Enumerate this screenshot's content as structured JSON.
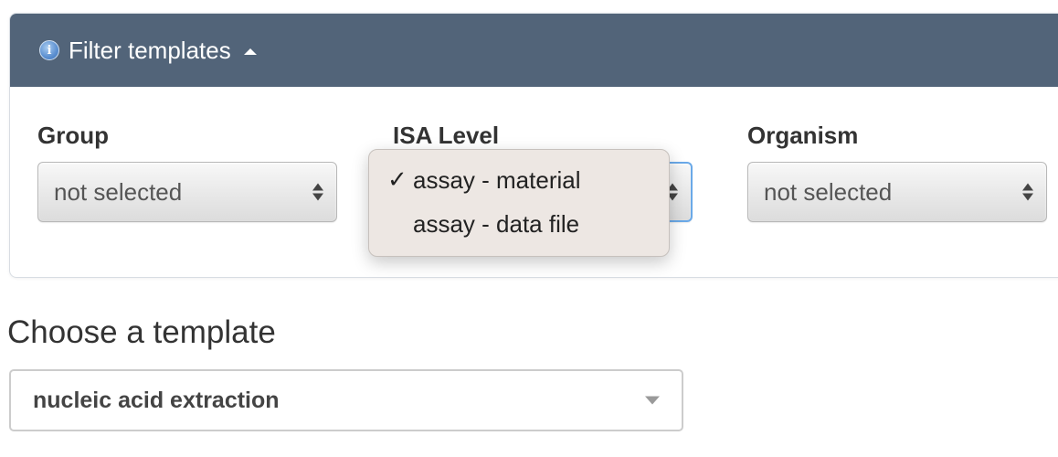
{
  "filter_panel": {
    "title": "Filter templates",
    "info_icon_glyph": "i",
    "fields": {
      "group": {
        "label": "Group",
        "value": "not selected"
      },
      "isa_level": {
        "label": "ISA Level",
        "dropdown_open": true,
        "options": [
          {
            "label": "assay - material",
            "selected": true,
            "check": "✓"
          },
          {
            "label": "assay - data file",
            "selected": false,
            "check": ""
          }
        ]
      },
      "organism": {
        "label": "Organism",
        "value": "not selected"
      }
    }
  },
  "template_chooser": {
    "heading": "Choose a template",
    "value": "nucleic acid extraction"
  },
  "colors": {
    "panel_header_bg": "#526479",
    "focus_ring": "#6aa9e8",
    "popup_bg": "#ede7e3"
  },
  "icons": [
    "info-icon",
    "caret-up-icon",
    "updown-arrows-icon",
    "checkmark-icon",
    "caret-down-icon"
  ]
}
